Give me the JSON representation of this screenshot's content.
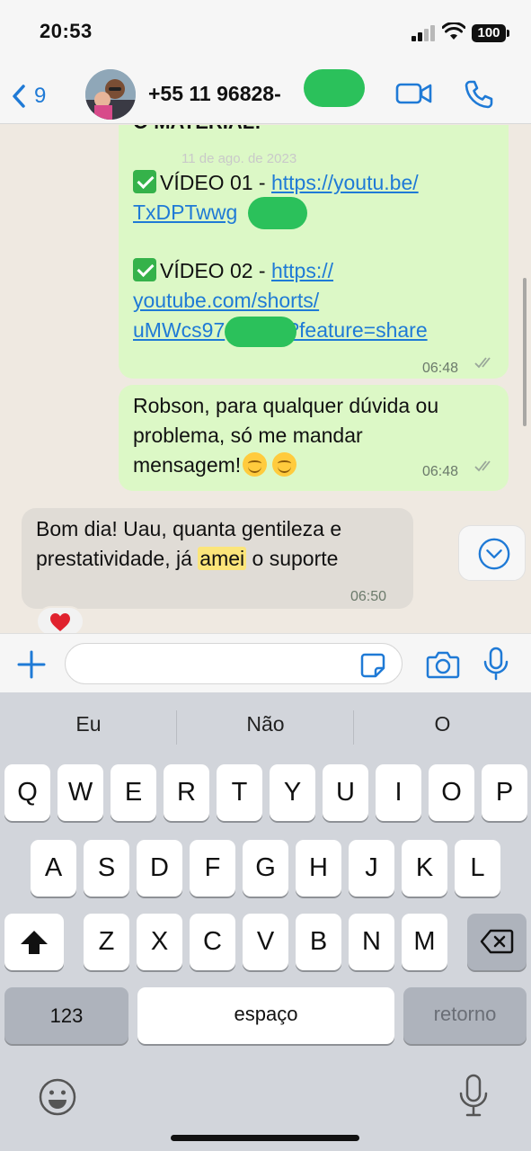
{
  "status_bar": {
    "time": "20:53",
    "battery": "100"
  },
  "header": {
    "back_count": "9",
    "contact_name": "+55 11 96828-"
  },
  "messages": {
    "top_partial_text": "O MATERIAL:",
    "date_overlay": "11 de ago. de 2023",
    "video1_label": "VÍDEO 01 - ",
    "video1_link_a": "https://youtu.be/",
    "video1_link_b": "TxDPTwwg",
    "video2_label": "VÍDEO 02 - ",
    "video2_link_a": "https://",
    "video2_link_b": "youtube.com/shorts/",
    "video2_link_c1": "uMWcs97",
    "video2_link_c2": "?feature=share",
    "time1": "06:48",
    "reply_text_1": "Robson, para qualquer dúvida ou",
    "reply_text_2": "problema, só me mandar",
    "reply_text_3": "mensagem!",
    "time2": "06:48",
    "incoming_1": "Bom dia! Uau, quanta gentileza e",
    "incoming_2a": "prestatividade, já ",
    "incoming_highlight": "amei",
    "incoming_2b": " o suporte",
    "time3": "06:50",
    "reaction": "❤️"
  },
  "input": {
    "value": "",
    "placeholder": ""
  },
  "keyboard": {
    "predictions": [
      "Eu",
      "Não",
      "O"
    ],
    "row1": [
      "Q",
      "W",
      "E",
      "R",
      "T",
      "Y",
      "U",
      "I",
      "O",
      "P"
    ],
    "row2": [
      "A",
      "S",
      "D",
      "F",
      "G",
      "H",
      "J",
      "K",
      "L"
    ],
    "row3": [
      "Z",
      "X",
      "C",
      "V",
      "B",
      "N",
      "M"
    ],
    "numbers_key": "123",
    "space_key": "espaço",
    "return_key": "retorno"
  },
  "colors": {
    "accent": "#1f7ad6",
    "outgoing_bubble": "#dcf8c6",
    "incoming_bubble": "#e0dcd6",
    "redaction": "#2bc15b",
    "highlight": "#fbe57a"
  }
}
